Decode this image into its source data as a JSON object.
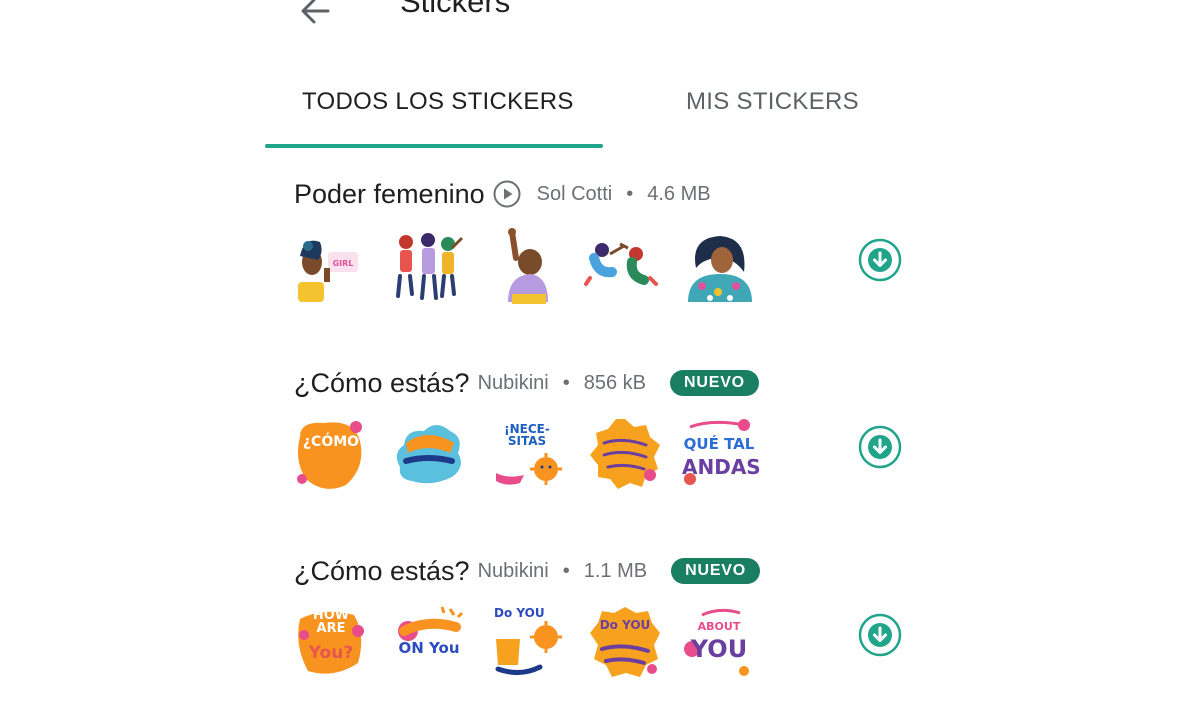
{
  "header": {
    "title": "Stickers",
    "back_icon": "arrow-left-icon"
  },
  "tabs": [
    {
      "label": "TODOS LOS STICKERS",
      "active": true
    },
    {
      "label": "MIS STICKERS",
      "active": false
    }
  ],
  "colors": {
    "accent": "#20a58a",
    "badge": "#1a7e62",
    "text_primary": "#1f1f1f",
    "text_secondary": "#6b7075"
  },
  "packs": [
    {
      "name": "Poder femenino",
      "author": "Sol Cotti",
      "size": "4.6 MB",
      "separator": "•",
      "badge": "",
      "has_play_icon": true,
      "download_icon": "download-circle-icon",
      "sticker_icons": [
        "woman-with-sign-sticker",
        "women-marching-sticker",
        "raised-fist-woman-sticker",
        "women-dancing-sticker",
        "woman-with-patterned-scarf-sticker"
      ]
    },
    {
      "name": "¿Cómo estás?",
      "author": "Nubikini",
      "size": "856 kB",
      "separator": "•",
      "badge": "NUEVO",
      "has_play_icon": false,
      "download_icon": "download-circle-icon",
      "sticker_icons": [
        "como-estas-lettering-sticker",
        "cloud-lettering-sticker",
        "necesitas-lettering-sticker",
        "orange-badge-lettering-sticker",
        "que-tal-andas-lettering-sticker"
      ]
    },
    {
      "name": "¿Cómo estás?",
      "author": "Nubikini",
      "size": "1.1 MB",
      "separator": "•",
      "badge": "NUEVO",
      "has_play_icon": false,
      "download_icon": "download-circle-icon",
      "sticker_icons": [
        "how-are-you-lettering-sticker",
        "checking-on-you-lettering-sticker",
        "do-you-need-lettering-sticker",
        "do-you-feel-lettering-sticker",
        "thinking-about-you-lettering-sticker"
      ]
    }
  ],
  "sticker_text": {
    "como": "¿CÓMO",
    "necesitas": "¡NECE-\nSITAS",
    "que_tal_andas_1": "QUÉ TAL",
    "que_tal_andas_2": "ANDAS",
    "how_are": "HOW\nARE",
    "you": "You?",
    "on_you": "ON You",
    "do_you": "Do YOU",
    "about_you": "ABOUT",
    "you2": "YOU"
  }
}
